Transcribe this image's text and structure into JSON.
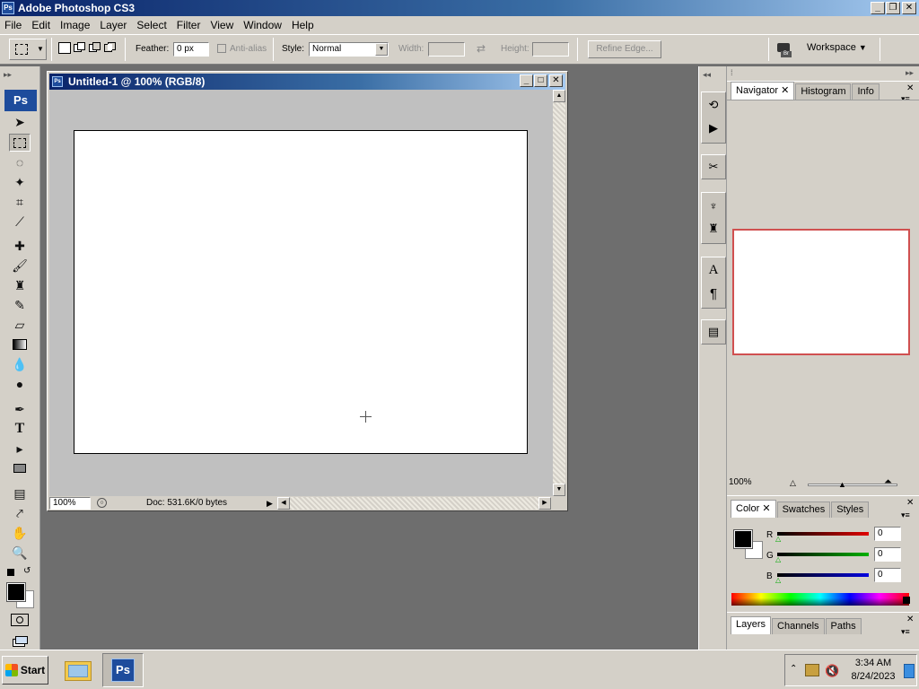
{
  "app": {
    "title": "Adobe Photoshop CS3",
    "ps_icon": "Ps",
    "menu": [
      "File",
      "Edit",
      "Image",
      "Layer",
      "Select",
      "Filter",
      "View",
      "Window",
      "Help"
    ]
  },
  "options": {
    "feather_label": "Feather:",
    "feather_value": "0 px",
    "antialias_label": "Anti-alias",
    "style_label": "Style:",
    "style_value": "Normal",
    "width_label": "Width:",
    "height_label": "Height:",
    "refine_edge": "Refine Edge...",
    "workspace": "Workspace"
  },
  "document": {
    "title": "Untitled-1 @ 100% (RGB/8)",
    "zoom": "100%",
    "doc_info": "Doc: 531.6K/0 bytes"
  },
  "navigator": {
    "tabs": [
      "Navigator",
      "Histogram",
      "Info"
    ],
    "zoom": "100%"
  },
  "color": {
    "tabs": [
      "Color",
      "Swatches",
      "Styles"
    ],
    "channels": [
      {
        "label": "R",
        "value": "0",
        "color": "#e00000"
      },
      {
        "label": "G",
        "value": "0",
        "color": "#00b000"
      },
      {
        "label": "B",
        "value": "0",
        "color": "#0000e0"
      }
    ]
  },
  "layers": {
    "tabs": [
      "Layers",
      "Channels",
      "Paths"
    ]
  },
  "taskbar": {
    "start": "Start",
    "time": "3:34 AM",
    "date": "8/24/2023"
  },
  "colors": {
    "title_blue": "#0a246a",
    "foreground": "#000000",
    "background": "#ffffff",
    "navigator_frame": "#d05050"
  }
}
